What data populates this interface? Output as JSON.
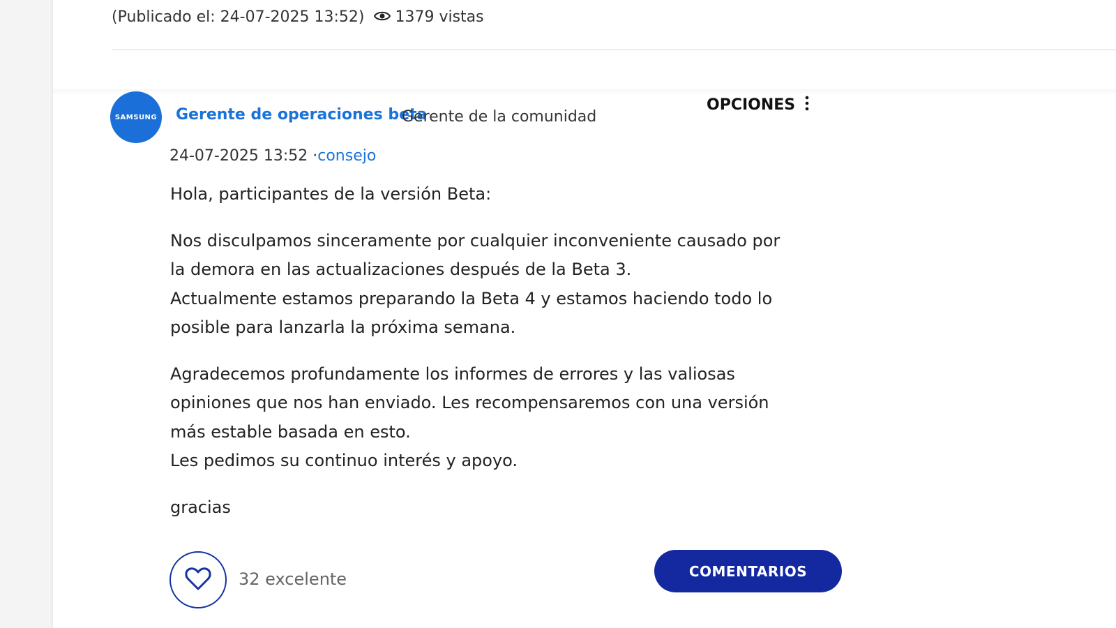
{
  "header": {
    "published": "(Publicado el: 24-07-2025 13:52)",
    "views": "1379 vistas"
  },
  "post": {
    "avatar_text": "SAMSUNG",
    "author": "Gerente de operaciones beta",
    "role": "Gerente de la comunidad",
    "options_label": "OPCIONES",
    "date": "24-07-2025 13:52",
    "separator": " ·",
    "tag": "consejo",
    "greeting": "Hola, participantes de la versión Beta:",
    "p1_l1": "Nos disculpamos sinceramente por cualquier inconveniente causado por",
    "p1_l2": "la demora en las actualizaciones después de la Beta 3.",
    "p1_l3": "Actualmente estamos preparando la Beta 4 y estamos haciendo todo lo",
    "p1_l4": "posible para lanzarla la próxima semana.",
    "p2_l1": "Agradecemos profundamente los informes de errores y las valiosas",
    "p2_l2": "opiniones que nos han enviado. Les recompensaremos con una versión",
    "p2_l3": "más estable basada en esto.",
    "p2_l4": "Les pedimos su continuo interés y apoyo.",
    "closing": "gracias",
    "likes": "32 excelente",
    "comments_label": "COMENTARIOS"
  },
  "colors": {
    "link": "#1a73d9",
    "button": "#1428a0",
    "avatar": "#1a6fd8"
  },
  "icons": [
    "eye-icon",
    "heart-icon",
    "more-vertical-icon"
  ]
}
